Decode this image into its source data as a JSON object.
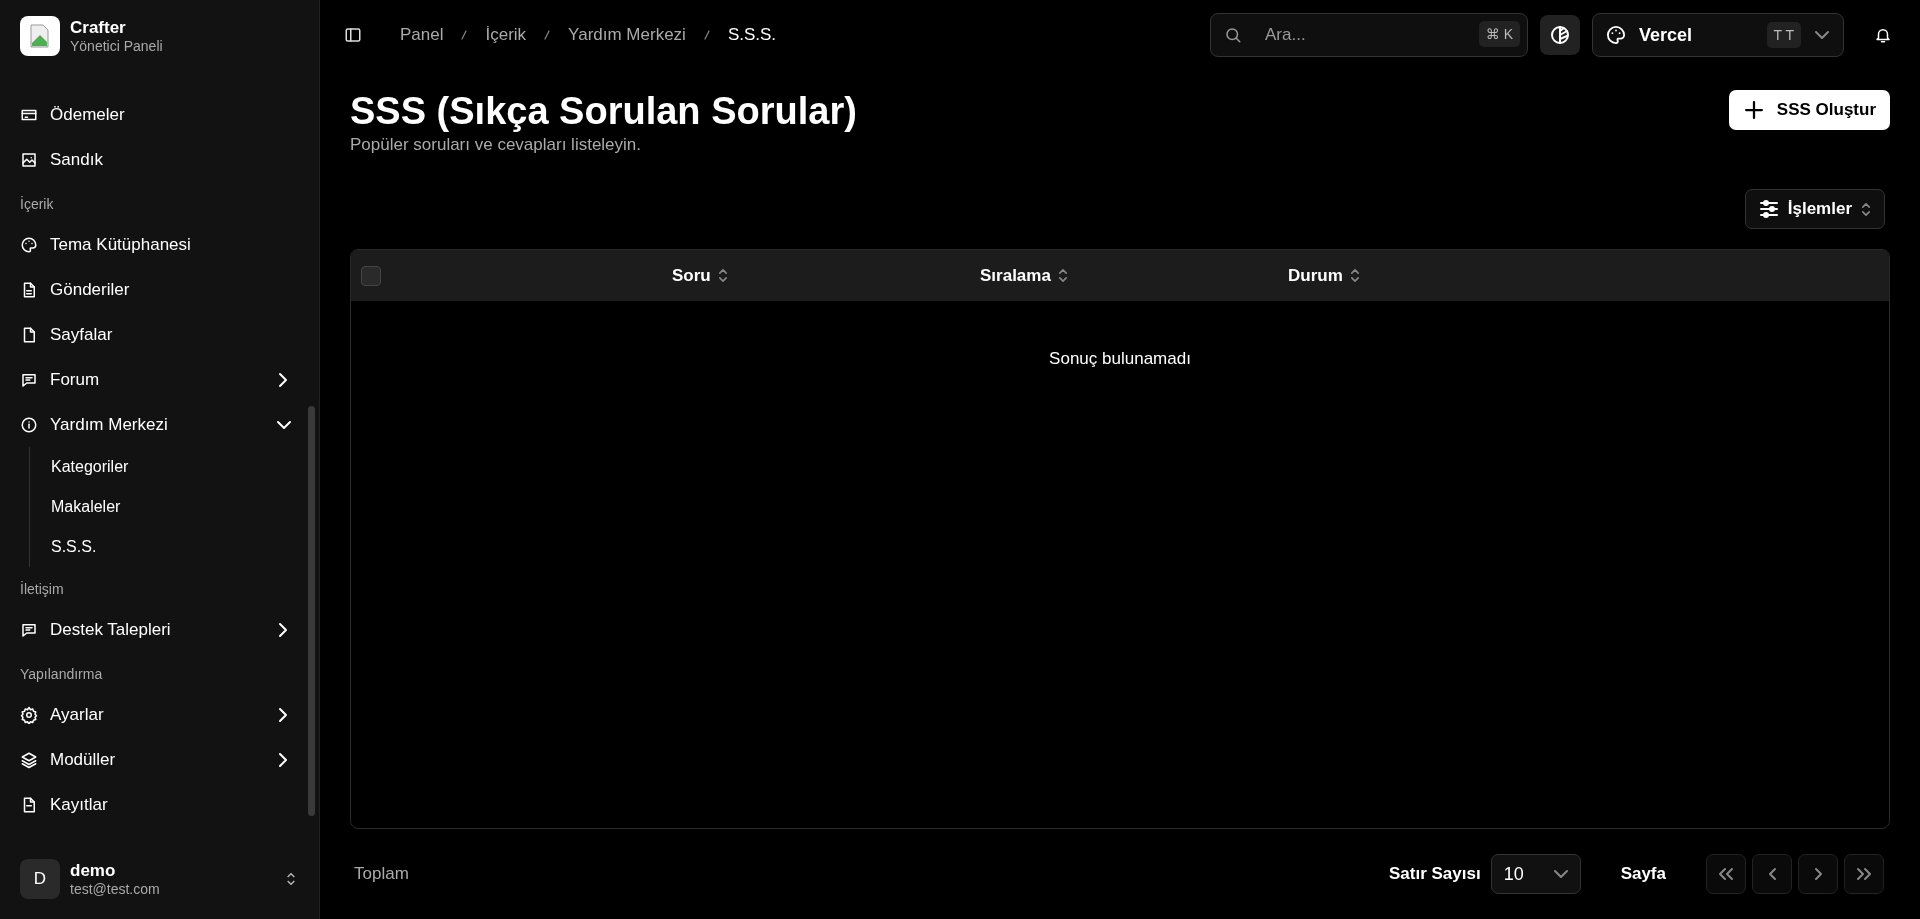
{
  "brand": {
    "name": "Crafter",
    "subtitle": "Yönetici Paneli"
  },
  "sidebar": {
    "sections": [
      {
        "items": [
          {
            "label": "Ödemeler",
            "kind": "link"
          },
          {
            "label": "Sandık",
            "kind": "link"
          }
        ]
      },
      {
        "title": "İçerik",
        "items": [
          {
            "label": "Tema Kütüphanesi",
            "kind": "link"
          },
          {
            "label": "Gönderiler",
            "kind": "link"
          },
          {
            "label": "Sayfalar",
            "kind": "link"
          },
          {
            "label": "Forum",
            "kind": "group",
            "expanded": false
          },
          {
            "label": "Yardım Merkezi",
            "kind": "group",
            "expanded": true,
            "children": [
              {
                "label": "Kategoriler"
              },
              {
                "label": "Makaleler"
              },
              {
                "label": "S.S.S."
              }
            ]
          }
        ]
      },
      {
        "title": "İletişim",
        "items": [
          {
            "label": "Destek Talepleri",
            "kind": "group",
            "expanded": false
          }
        ]
      },
      {
        "title": "Yapılandırma",
        "items": [
          {
            "label": "Ayarlar",
            "kind": "group",
            "expanded": false
          },
          {
            "label": "Modüller",
            "kind": "group",
            "expanded": false
          },
          {
            "label": "Kayıtlar",
            "kind": "link"
          }
        ]
      }
    ]
  },
  "user": {
    "initial": "D",
    "name": "demo",
    "email": "test@test.com"
  },
  "breadcrumb": [
    "Panel",
    "İçerik",
    "Yardım Merkezi",
    "S.S.S."
  ],
  "search": {
    "placeholder": "Ara...",
    "shortcut": [
      "⌘",
      "K"
    ]
  },
  "theme": {
    "name": "Vercel",
    "badge": "T T"
  },
  "page": {
    "title": "SSS (Sıkça Sorulan Sorular)",
    "subtitle": "Popüler soruları ve cevapları listeleyin.",
    "create_button": "SSS Oluştur",
    "actions_button": "İşlemler"
  },
  "table": {
    "select_all": {
      "checked": false
    },
    "columns": [
      "Soru",
      "Sıralama",
      "Durum"
    ],
    "empty": "Sonuç bulunamadı"
  },
  "footer": {
    "total": "Toplam",
    "rows_label": "Satır Sayısı",
    "rows_value": "10",
    "page_label": "Sayfa"
  }
}
